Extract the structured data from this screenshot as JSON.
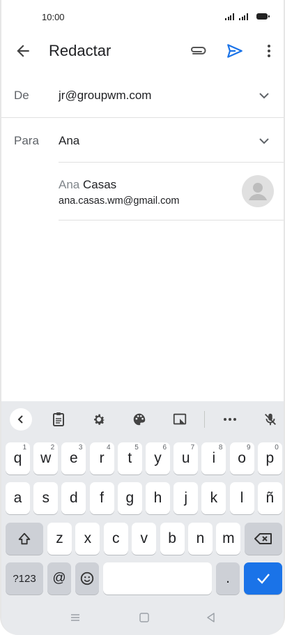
{
  "status_bar": {
    "time": "10:00"
  },
  "app_bar": {
    "title": "Redactar"
  },
  "from": {
    "label": "De",
    "value": "jr@groupwm.com"
  },
  "to": {
    "label": "Para",
    "value": "Ana"
  },
  "suggestion": {
    "name_match": "Ana",
    "name_rest": " Casas",
    "email": "ana.casas.wm@gmail.com"
  },
  "keyboard": {
    "row1": [
      {
        "k": "q",
        "s": "1"
      },
      {
        "k": "w",
        "s": "2"
      },
      {
        "k": "e",
        "s": "3"
      },
      {
        "k": "r",
        "s": "4"
      },
      {
        "k": "t",
        "s": "5"
      },
      {
        "k": "y",
        "s": "6"
      },
      {
        "k": "u",
        "s": "7"
      },
      {
        "k": "i",
        "s": "8"
      },
      {
        "k": "o",
        "s": "9"
      },
      {
        "k": "p",
        "s": "0"
      }
    ],
    "row2": [
      "a",
      "s",
      "d",
      "f",
      "g",
      "h",
      "j",
      "k",
      "l",
      "ñ"
    ],
    "row3": [
      "z",
      "x",
      "c",
      "v",
      "b",
      "n",
      "m"
    ],
    "symbols_label": "?123",
    "at_label": "@",
    "period_label": ".",
    "accent_color": "#1a73e8"
  },
  "icons": {
    "app_bar": [
      "back-arrow-icon",
      "paperclip-icon",
      "send-icon",
      "more-vert-icon"
    ],
    "toolbar": [
      "chevron-left-icon",
      "clipboard-icon",
      "gear-icon",
      "palette-icon",
      "floating-keyboard-icon",
      "more-horiz-icon",
      "mic-off-icon"
    ],
    "nav": [
      "recents-icon",
      "home-icon",
      "back-icon"
    ]
  }
}
